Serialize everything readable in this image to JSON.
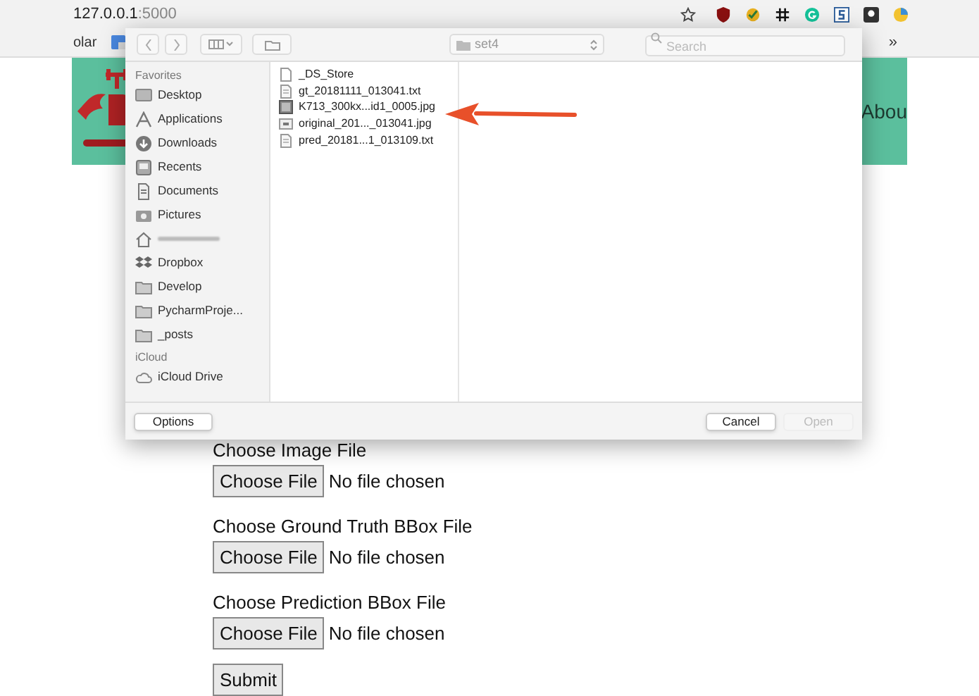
{
  "browser": {
    "address": {
      "host": "127.0.0.1",
      "port": ":5000"
    },
    "bookmarks": [
      {
        "label": "olar"
      }
    ],
    "overflow": "»"
  },
  "dialog": {
    "folder": "set4",
    "search": {
      "placeholder": "Search"
    },
    "sidebar": [
      {
        "heading": "Favorites",
        "items": [
          {
            "kind": "desktop",
            "label": "Desktop"
          },
          {
            "kind": "apps",
            "label": "Applications"
          },
          {
            "kind": "downloads",
            "label": "Downloads"
          },
          {
            "kind": "recents",
            "label": "Recents"
          },
          {
            "kind": "documents",
            "label": "Documents"
          },
          {
            "kind": "pictures",
            "label": "Pictures"
          },
          {
            "kind": "home"
          },
          {
            "kind": "dropbox",
            "label": "Dropbox"
          },
          {
            "kind": "folder",
            "label": "Develop"
          },
          {
            "kind": "folder",
            "label": "PycharmProje..."
          },
          {
            "kind": "folder",
            "label": "_posts"
          }
        ]
      },
      {
        "heading": "iCloud",
        "items": [
          {
            "kind": "cloud",
            "label": "iCloud Drive"
          }
        ]
      }
    ],
    "files": [
      {
        "name": "_DS_Store",
        "kind": "blank"
      },
      {
        "name": "gt_20181111_013041.txt",
        "kind": "text"
      },
      {
        "name": "K713_300kx...id1_0005.jpg",
        "kind": "image"
      },
      {
        "name": "original_201..._013041.jpg",
        "kind": "jpg"
      },
      {
        "name": "pred_20181...1_013109.txt",
        "kind": "text"
      }
    ],
    "buttons": [
      {
        "label": "Options",
        "disabled": false
      },
      {
        "label": "Cancel",
        "disabled": false
      },
      {
        "label": "Open",
        "disabled": true
      }
    ]
  },
  "page": {
    "nav_item": "Abou",
    "fields": [
      {
        "label": "Choose Image File",
        "button": "Choose File",
        "status": "No file chosen"
      },
      {
        "label": "Choose Ground Truth BBox File",
        "button": "Choose File",
        "status": "No file chosen"
      },
      {
        "label": "Choose Prediction BBox File",
        "button": "Choose File",
        "status": "No file chosen"
      }
    ],
    "submit": "Submit"
  }
}
